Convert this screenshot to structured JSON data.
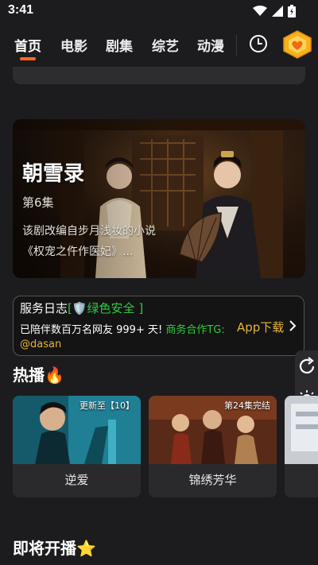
{
  "status": {
    "time": "3:41"
  },
  "nav": {
    "tabs": [
      {
        "label": "首页",
        "active": true
      },
      {
        "label": "电影"
      },
      {
        "label": "剧集"
      },
      {
        "label": "综艺"
      },
      {
        "label": "动漫"
      }
    ],
    "history_icon": "clock-icon",
    "vip_icon": "heart-gem-icon"
  },
  "banner": {
    "title": "朝雪录",
    "episode": "第6集",
    "description": "该剧改编自步月浅妆的小说《权宠之仵作医妃》..."
  },
  "notice": {
    "title": "服务日志",
    "badge": "[🛡️绿色安全 ]",
    "line2_prefix": "已陪伴数百万名网友 999+ 天! ",
    "line2_highlight": "商务合作TG:",
    "line3": "@dasan",
    "app_download": "App下载"
  },
  "side_tools": [
    "refresh-icon",
    "brightness-icon",
    "feedback-icon"
  ],
  "hot": {
    "title": "热播🔥",
    "items": [
      {
        "title": "逆爱",
        "badge": "更新至【10】"
      },
      {
        "title": "锦绣芳华",
        "badge": "第24集完结"
      },
      {
        "title": "",
        "badge": ""
      }
    ]
  },
  "upcoming": {
    "title": "即将开播⭐"
  },
  "colors": {
    "background": "#1c1c1e",
    "accent": "#ff6a1a",
    "gold": "#e7b43a",
    "green": "#2ecc40"
  }
}
